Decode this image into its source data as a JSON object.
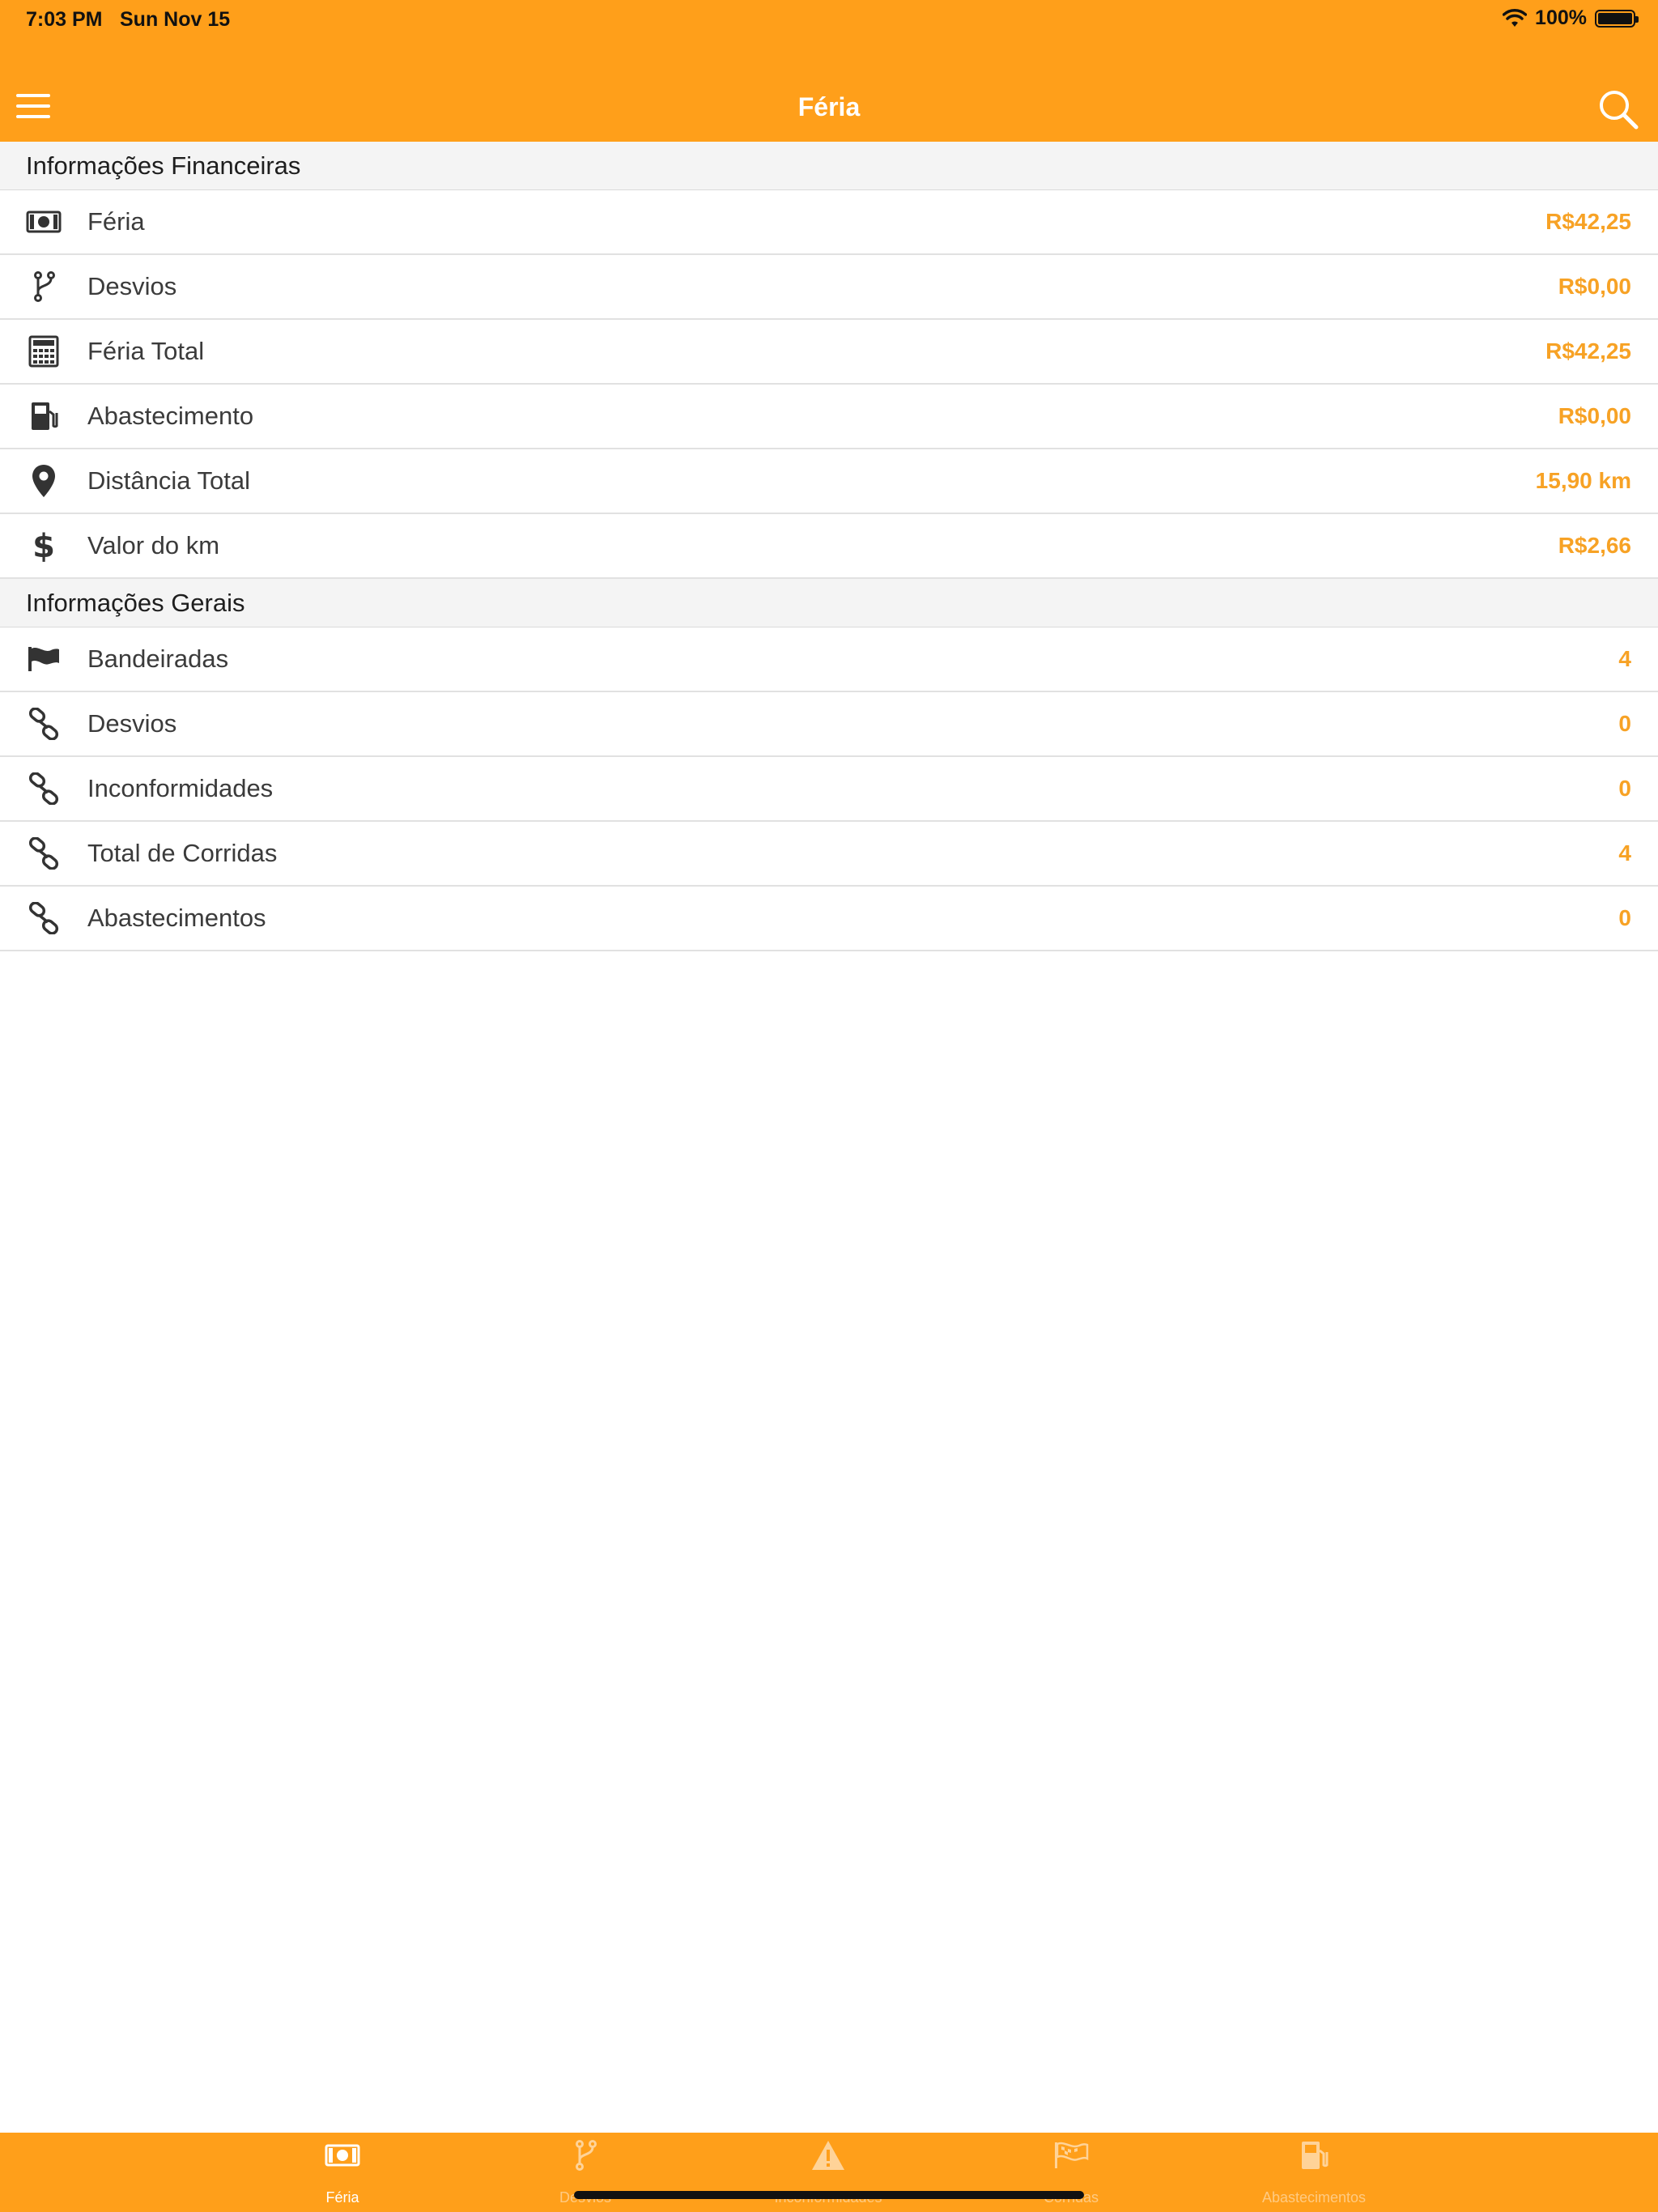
{
  "status_bar": {
    "time": "7:03 PM",
    "date": "Sun Nov 15",
    "battery": "100%"
  },
  "nav": {
    "title": "Féria",
    "menu_icon": "hamburger-icon",
    "search_icon": "search-icon"
  },
  "sections": {
    "financial": {
      "title": "Informações Financeiras",
      "rows": [
        {
          "label": "Féria",
          "value": "R$42,25",
          "icon": "money-icon"
        },
        {
          "label": "Desvios",
          "value": "R$0,00",
          "icon": "branch-icon"
        },
        {
          "label": "Féria Total",
          "value": "R$42,25",
          "icon": "calculator-icon"
        },
        {
          "label": "Abastecimento",
          "value": "R$0,00",
          "icon": "fuel-icon"
        },
        {
          "label": "Distância Total",
          "value": "15,90 km",
          "icon": "location-pin-icon"
        },
        {
          "label": "Valor do km",
          "value": "R$2,66",
          "icon": "dollar-icon"
        }
      ]
    },
    "general": {
      "title": "Informações Gerais",
      "rows": [
        {
          "label": "Bandeiradas",
          "value": "4",
          "icon": "flag-icon"
        },
        {
          "label": "Desvios",
          "value": "0",
          "icon": "link-icon"
        },
        {
          "label": "Inconformidades",
          "value": "0",
          "icon": "link-icon"
        },
        {
          "label": "Total de Corridas",
          "value": "4",
          "icon": "link-icon"
        },
        {
          "label": "Abastecimentos",
          "value": "0",
          "icon": "link-icon"
        }
      ]
    }
  },
  "tabs": [
    {
      "label": "Féria",
      "icon": "money-icon",
      "active": true
    },
    {
      "label": "Desvios",
      "icon": "branch-icon",
      "active": false
    },
    {
      "label": "Inconformidades",
      "icon": "warning-icon",
      "active": false
    },
    {
      "label": "Corridas",
      "icon": "checkered-flag-icon",
      "active": false
    },
    {
      "label": "Abastecimentos",
      "icon": "fuel-icon",
      "active": false
    }
  ],
  "colors": {
    "primary": "#FF9F1A",
    "value_text": "#F7A225",
    "section_bg": "#F4F4F4"
  }
}
